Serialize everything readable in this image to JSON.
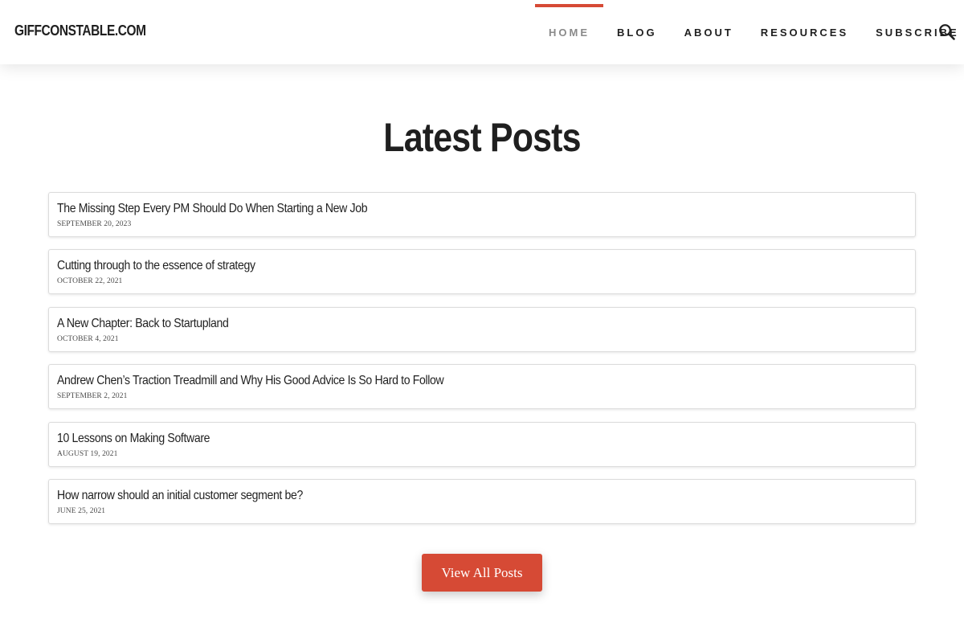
{
  "site": {
    "logo": "GIFFCONSTABLE.COM",
    "accent_color": "#d64a35"
  },
  "nav": {
    "items": [
      {
        "label": "HOME",
        "active": true
      },
      {
        "label": "BLOG",
        "active": false
      },
      {
        "label": "ABOUT",
        "active": false
      },
      {
        "label": "RESOURCES",
        "active": false
      },
      {
        "label": "SUBSCRIBE",
        "active": false
      }
    ],
    "search_icon": "search-icon"
  },
  "main": {
    "title": "Latest Posts",
    "posts": [
      {
        "title": "The Missing Step Every PM Should Do When Starting a New Job",
        "date": "SEPTEMBER 20, 2023"
      },
      {
        "title": "Cutting through to the essence of strategy",
        "date": "OCTOBER 22, 2021"
      },
      {
        "title": "A New Chapter: Back to Startupland",
        "date": "OCTOBER 4, 2021"
      },
      {
        "title": "Andrew Chen’s Traction Treadmill and Why His Good Advice Is So Hard to Follow",
        "date": "SEPTEMBER 2, 2021"
      },
      {
        "title": "10 Lessons on Making Software",
        "date": "AUGUST 19, 2021"
      },
      {
        "title": "How narrow should an initial customer segment be?",
        "date": "JUNE 25, 2021"
      }
    ],
    "view_all_label": "View All Posts"
  }
}
